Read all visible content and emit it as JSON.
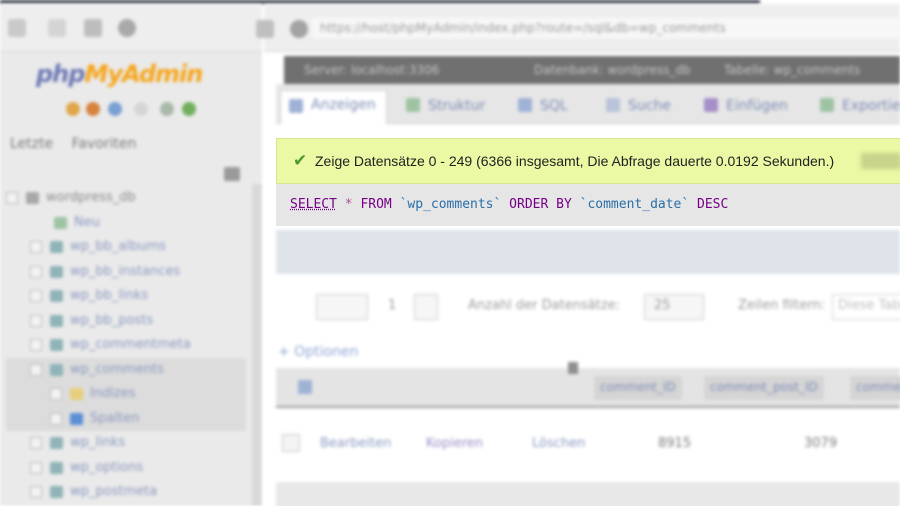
{
  "browser": {
    "url_text": "https://host/phpMyAdmin/index.php?route=/sql&db=wp_comments"
  },
  "nav": {
    "logo": {
      "prefix": "php",
      "suffix": "MyAdmin"
    },
    "tabs": [
      "Letzte",
      "Favoriten"
    ],
    "db_name": "wordpress_db",
    "tree": [
      {
        "label": "Neu"
      },
      {
        "label": "wp_bb_albums"
      },
      {
        "label": "wp_bb_instances"
      },
      {
        "label": "wp_bb_links"
      },
      {
        "label": "wp_bb_posts"
      },
      {
        "label": "wp_commentmeta"
      },
      {
        "label": "wp_comments"
      },
      {
        "label": "Indizes"
      },
      {
        "label": "Spalten"
      },
      {
        "label": "wp_links"
      },
      {
        "label": "wp_options"
      },
      {
        "label": "wp_postmeta"
      }
    ]
  },
  "breadcrumbs": [
    "Server: localhost:3306",
    "Datenbank: wordpress_db",
    "Tabelle: wp_comments"
  ],
  "tabs": [
    "Anzeigen",
    "Struktur",
    "SQL",
    "Suche",
    "Einfügen",
    "Exportieren"
  ],
  "result": {
    "message": "Zeige Datensätze 0 - 249 (6366 insgesamt, Die Abfrage dauerte 0.0192 Sekunden.)"
  },
  "sql": {
    "select": "SELECT",
    "star": "*",
    "from": "FROM",
    "table": "`wp_comments`",
    "order_by": "ORDER BY",
    "column": "`comment_date`",
    "direction": "DESC"
  },
  "pager": {
    "page": "1",
    "rows_label": "Anzahl der Datensätze:",
    "rows_value": "25",
    "filter_label": "Zeilen filtern:",
    "filter_placeholder": "Diese Tabelle durchsuchen"
  },
  "options_label": "+ Optionen",
  "columns": [
    "comment_ID",
    "comment_post_ID",
    "comment_author"
  ],
  "row_actions": [
    "Bearbeiten",
    "Kopieren",
    "Löschen"
  ],
  "first_row": {
    "id": "8915",
    "post_id": "3079"
  }
}
